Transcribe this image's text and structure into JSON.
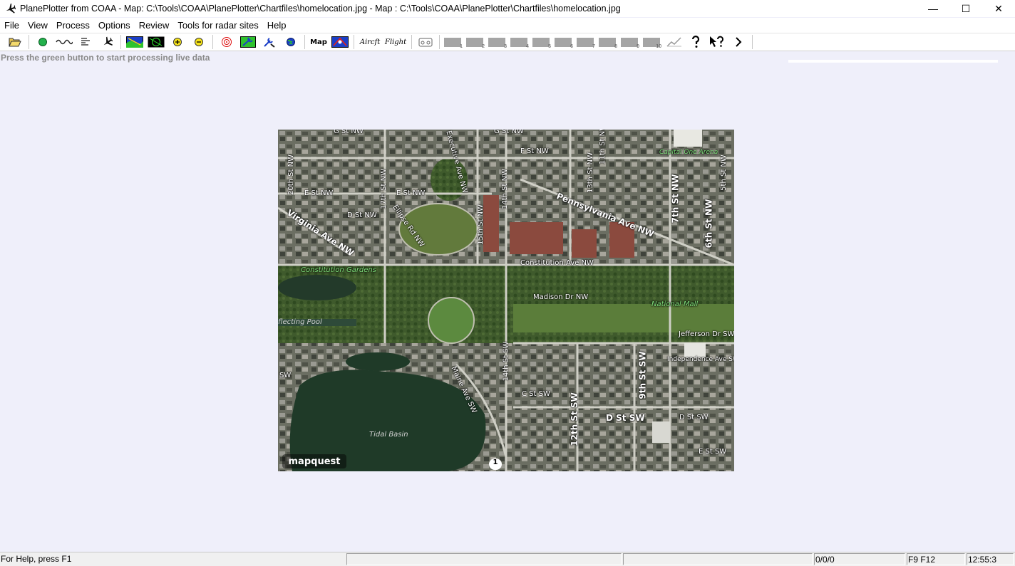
{
  "window": {
    "title": "PlanePlotter from COAA - Map: C:\\Tools\\COAA\\PlanePlotter\\Chartfiles\\homelocation.jpg - Map : C:\\Tools\\COAA\\PlanePlotter\\Chartfiles\\homelocation.jpg",
    "minimize_glyph": "—",
    "maximize_glyph": "☐",
    "close_glyph": "✕"
  },
  "menu": [
    "File",
    "View",
    "Process",
    "Options",
    "Review",
    "Tools for radar sites",
    "Help"
  ],
  "toolbar": {
    "aircraft_label": "Aircft",
    "flight_label": "Flight",
    "map_label": "Map",
    "slots": [
      "1",
      "2",
      "3",
      "4",
      "5",
      "6",
      "7",
      "8",
      "9",
      "10"
    ]
  },
  "status_message": "Press the green button to start processing live data",
  "map": {
    "labels": {
      "g_st_nw_1": "G St NW",
      "g_st_nw_2": "G St NW",
      "f_st_nw": "F St NW",
      "e_st_nw_1": "E St NW",
      "e_st_nw_2": "E St NW",
      "d_st_nw": "D St NW",
      "st_20th": "20th St NW",
      "st_17th": "17th St NW",
      "st_15th": "15th St NW",
      "st_14th": "14th St NW",
      "st_13th": "13th St NW",
      "st_11th": "11th St NW",
      "st_7th": "7th St NW",
      "st_6th": "6th St NW",
      "st_5th": "5th St NW",
      "executive_ave": "Executive Ave NW",
      "ellipse_rd": "Ellipse Rd NW",
      "pennsylvania": "Pennsylvania Ave NW",
      "virginia": "Virginia Ave NW",
      "constitution": "Constitution Ave NW",
      "madison": "Madison Dr NW",
      "jefferson": "Jefferson Dr SW",
      "independence": "Independence Ave SW",
      "c_st_sw": "C St SW",
      "d_st_sw_1": "D St SW",
      "d_st_sw_2": "D St SW",
      "e_st_sw": "E St SW",
      "st_12th": "12th St SW",
      "st_9th": "9th St SW",
      "st_14th_sw": "14th St SW",
      "maine_ave": "Maine Ave SW",
      "constitution_gardens": "Constitution Gardens",
      "national_mall": "National Mall",
      "capital_one": "Capital One Arena",
      "reflecting_pool": "flecting Pool",
      "tidal_basin": "Tidal Basin",
      "sw": "SW",
      "route_1": "1",
      "logo": "mapquest"
    }
  },
  "statusbar": {
    "help": "For Help, press F1",
    "counts": "0/0/0",
    "keys": "F9 F12",
    "time": "12:55:3"
  }
}
